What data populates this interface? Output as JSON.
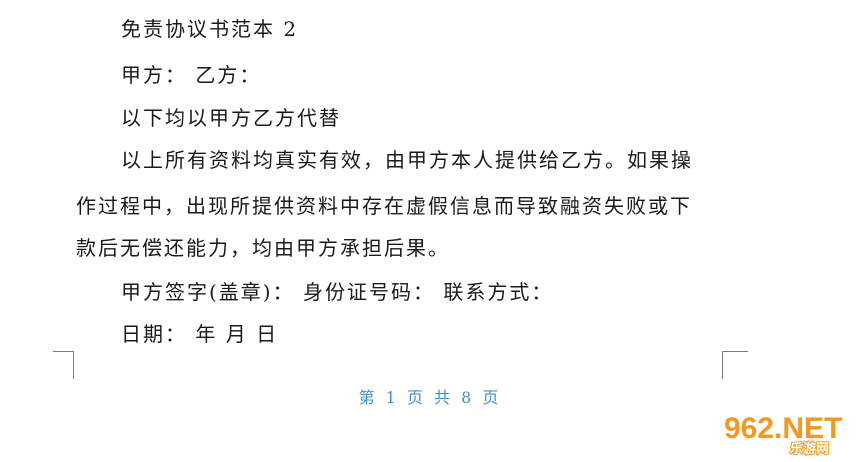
{
  "document": {
    "title": "免责协议书范本 2",
    "parties": "甲方：  乙方：",
    "substitution": "以下均以甲方乙方代替",
    "body": [
      "以上所有资料均真实有效，由甲方本人提供给乙方。如果操",
      "作过程中，出现所提供资料中存在虚假信息而导致融资失败或下",
      "款后无偿还能力，均由甲方承担后果。"
    ],
    "signature_line": "甲方签字(盖章)：  身份证号码：  联系方式：",
    "date_line": "日期：  年  月  日"
  },
  "footer": {
    "page_indicator": "第 1 页 共 8 页"
  },
  "watermark": {
    "logo_text": "962.NET",
    "logo_subtext": "乐游网",
    "colors": {
      "orange": "#f39a1e",
      "white": "#ffffff"
    }
  }
}
